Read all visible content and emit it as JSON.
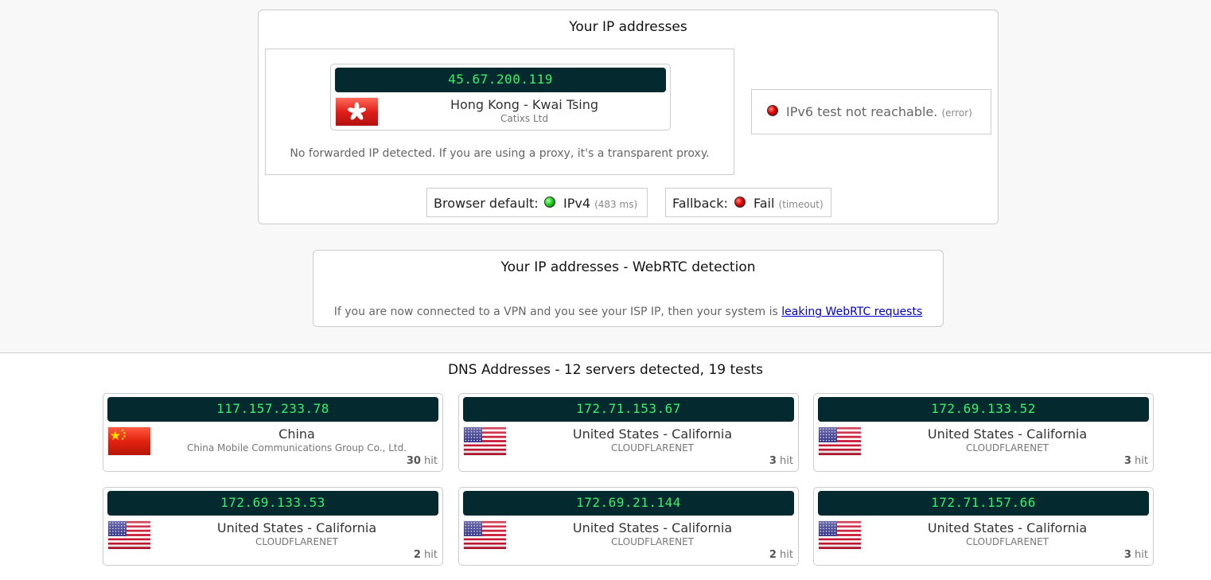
{
  "ip_panel": {
    "title": "Your IP addresses",
    "ipv4": {
      "ip": "45.67.200.119",
      "location": "Hong Kong - Kwai Tsing",
      "isp": "Catixs Ltd",
      "flag": "hong-kong-flag"
    },
    "forward_note": "No forwarded IP detected. If you are using a proxy, it's a transparent proxy.",
    "ipv6": {
      "text": "IPv6 test not reachable.",
      "detail": "(error)",
      "status_color": "#e00000"
    },
    "browser_default": {
      "label": "Browser default:",
      "protocol": "IPv4",
      "latency": "(483 ms)",
      "status_color": "#1ed01e"
    },
    "fallback": {
      "label": "Fallback:",
      "result": "Fail",
      "detail": "(timeout)",
      "status_color": "#e00000"
    }
  },
  "webrtc_panel": {
    "title": "Your IP addresses - WebRTC detection",
    "note": "If you are now connected to a VPN and you see your ISP IP, then your system is",
    "link": "leaking WebRTC requests"
  },
  "dns": {
    "title": "DNS Addresses - 12 servers detected, 19 tests",
    "hit_suffix": "hit",
    "servers": [
      {
        "ip": "117.157.233.78",
        "location": "China",
        "isp": "China Mobile Communications Group Co., Ltd.",
        "hits": "30",
        "flag": "china-flag"
      },
      {
        "ip": "172.71.153.67",
        "location": "United States - California",
        "isp": "CLOUDFLARENET",
        "hits": "3",
        "flag": "us-flag"
      },
      {
        "ip": "172.69.133.52",
        "location": "United States - California",
        "isp": "CLOUDFLARENET",
        "hits": "3",
        "flag": "us-flag"
      },
      {
        "ip": "172.69.133.53",
        "location": "United States - California",
        "isp": "CLOUDFLARENET",
        "hits": "2",
        "flag": "us-flag"
      },
      {
        "ip": "172.69.21.144",
        "location": "United States - California",
        "isp": "CLOUDFLARENET",
        "hits": "2",
        "flag": "us-flag"
      },
      {
        "ip": "172.71.157.66",
        "location": "United States - California",
        "isp": "CLOUDFLARENET",
        "hits": "3",
        "flag": "us-flag"
      }
    ]
  },
  "colors": {
    "ip_bar_bg": "#04292f",
    "ip_text": "#36f26a",
    "link": "#0000cc"
  }
}
